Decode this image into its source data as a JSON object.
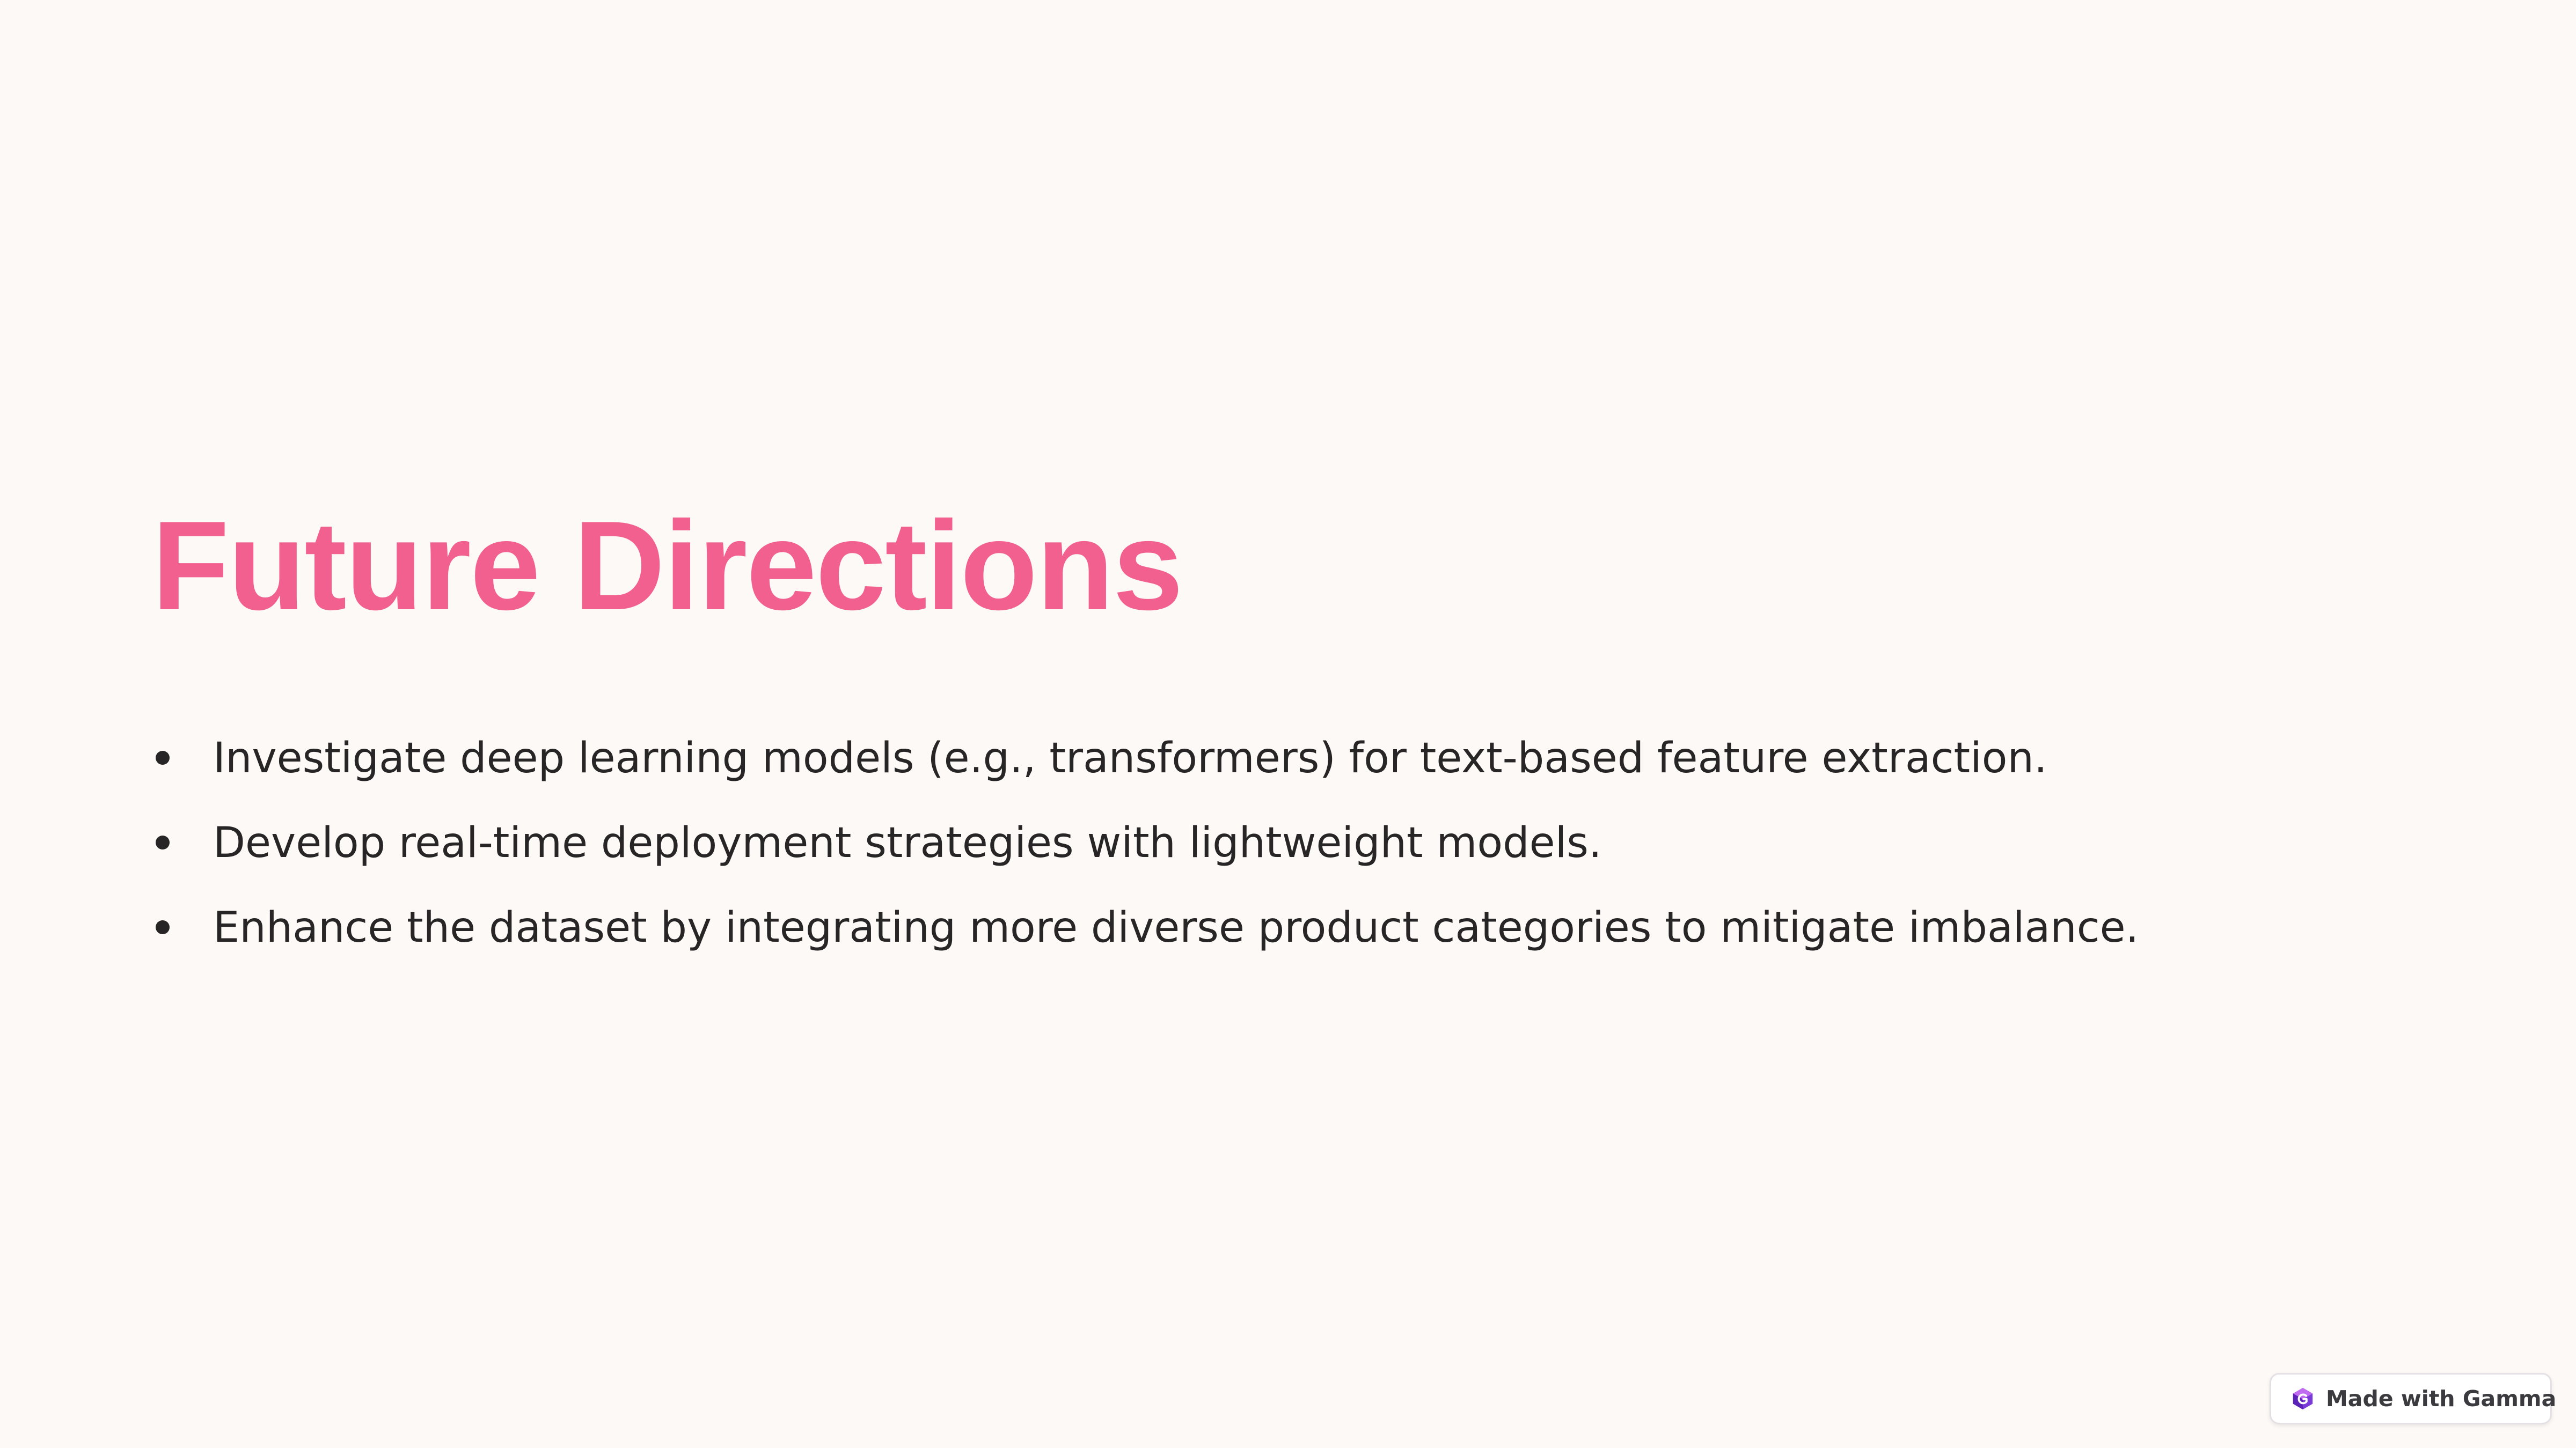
{
  "slide": {
    "title": "Future Directions",
    "bullets": [
      "Investigate deep learning models (e.g., transformers) for text-based feature extraction.",
      "Develop real-time deployment strategies with lightweight models.",
      "Enhance the dataset by integrating more diverse product categories to mitigate imbalance."
    ]
  },
  "badge": {
    "label": "Made with Gamma",
    "icon": "gamma-logo-icon"
  },
  "colors": {
    "background": "#fdf9f6",
    "title": "#f2608f",
    "text": "#272525",
    "badge_border": "#e4e1e4"
  }
}
